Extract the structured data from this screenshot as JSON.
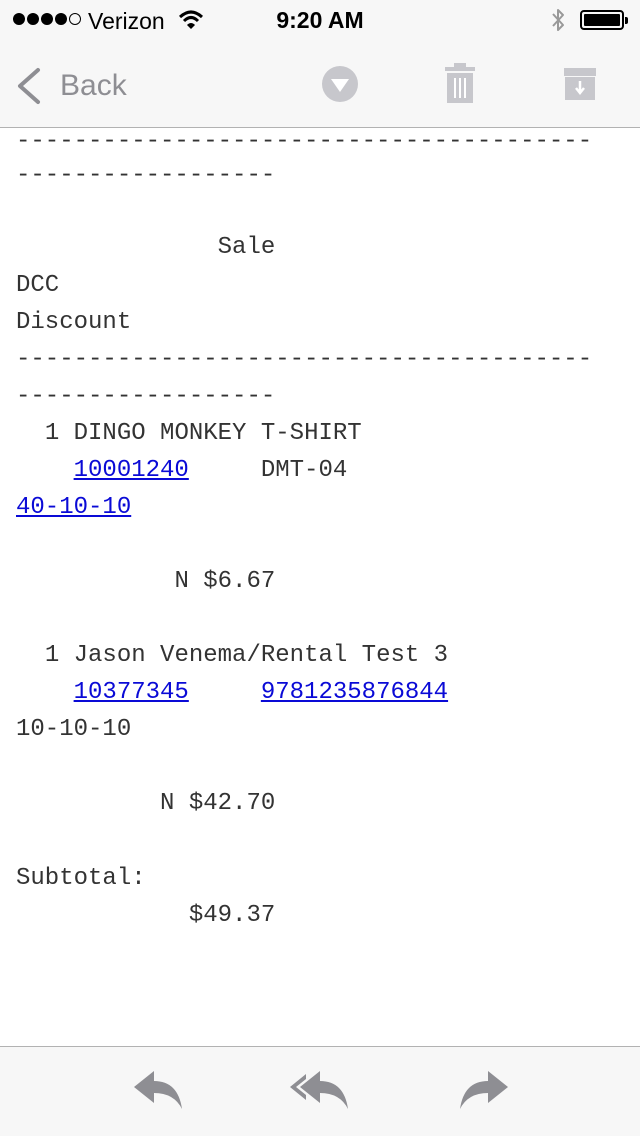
{
  "status_bar": {
    "carrier": "Verizon",
    "time": "9:20 AM",
    "signal_bars_filled": 4,
    "signal_bars_total": 5,
    "icons": [
      "wifi-icon",
      "bluetooth-icon",
      "battery-icon"
    ]
  },
  "nav": {
    "back_label": "Back",
    "icons": [
      "chevron-down-circle-icon",
      "trash-icon",
      "archive-icon"
    ],
    "icon_color": "#c7c7cc"
  },
  "email": {
    "separator": "----------------------------------------",
    "separator_tail": "------------------",
    "heading": "Sale",
    "lines": [
      "DCC",
      "Discount"
    ],
    "items": [
      {
        "qty": "1",
        "description": "DINGO MONKEY T-SHIRT",
        "sku": "10001240",
        "code": "DMT-04",
        "code_is_link": false,
        "tax_code": "40-10-10",
        "tax_code_is_link": true,
        "tax_flag": "N",
        "price": "$6.67"
      },
      {
        "qty": "1",
        "description": "Jason Venema/Rental Test 3",
        "sku": "10377345",
        "code": "9781235876844",
        "code_is_link": true,
        "tax_code": "10-10-10",
        "tax_code_is_link": false,
        "tax_flag": "N",
        "price": "$42.70"
      }
    ],
    "subtotal_label": "Subtotal:",
    "subtotal_value": "$49.37",
    "link_color": "#0a0ad6"
  },
  "toolbar": {
    "icons": [
      "reply-icon",
      "reply-all-icon",
      "forward-icon"
    ],
    "icon_color": "#8e8e93"
  }
}
